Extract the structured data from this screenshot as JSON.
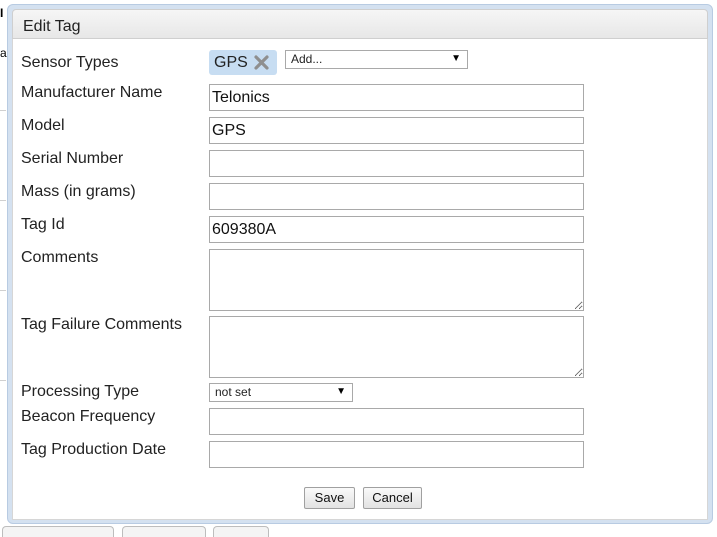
{
  "dialog": {
    "title": "Edit Tag"
  },
  "fields": {
    "sensor_types": {
      "label": "Sensor Types",
      "selected_chip": "GPS",
      "add_placeholder": "Add..."
    },
    "manufacturer_name": {
      "label": "Manufacturer Name",
      "value": "Telonics"
    },
    "model": {
      "label": "Model",
      "value": "GPS"
    },
    "serial_number": {
      "label": "Serial Number",
      "value": ""
    },
    "mass": {
      "label": "Mass (in grams)",
      "value": ""
    },
    "tag_id": {
      "label": "Tag Id",
      "value": "609380A"
    },
    "comments": {
      "label": "Comments",
      "value": ""
    },
    "tag_failure_comments": {
      "label": "Tag Failure Comments",
      "value": ""
    },
    "processing_type": {
      "label": "Processing Type",
      "selected": "not set"
    },
    "beacon_frequency": {
      "label": "Beacon Frequency",
      "value": ""
    },
    "tag_production_date": {
      "label": "Tag Production Date",
      "value": ""
    }
  },
  "buttons": {
    "save": "Save",
    "cancel": "Cancel"
  },
  "icons": {
    "chip_remove": "close-icon",
    "dropdown": "triangle-down-icon"
  },
  "colors": {
    "dialog_frame": "#d4e1f0",
    "chip_background": "#c7ddf2"
  }
}
